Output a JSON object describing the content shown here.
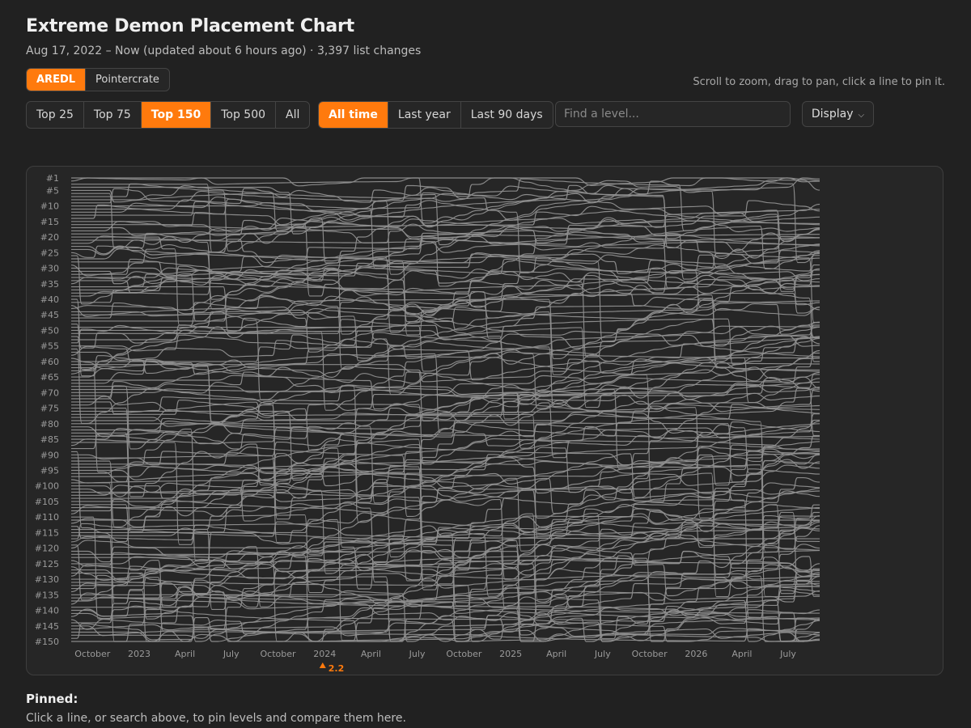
{
  "header": {
    "title": "Extreme Demon Placement Chart",
    "subtitle": "Aug 17, 2022 – Now (updated about 6 hours ago) · 3,397 list changes"
  },
  "source_tabs": [
    {
      "label": "AREDL",
      "active": true
    },
    {
      "label": "Pointercrate",
      "active": false
    }
  ],
  "hint": "Scroll to zoom, drag to pan, click a line to pin it.",
  "range_tabs": [
    {
      "label": "Top 25",
      "active": false
    },
    {
      "label": "Top 75",
      "active": false
    },
    {
      "label": "Top 150",
      "active": true
    },
    {
      "label": "Top 500",
      "active": false
    },
    {
      "label": "All",
      "active": false
    }
  ],
  "time_tabs": [
    {
      "label": "All time",
      "active": true
    },
    {
      "label": "Last year",
      "active": false
    },
    {
      "label": "Last 90 days",
      "active": false
    }
  ],
  "search": {
    "placeholder": "Find a level...",
    "value": ""
  },
  "display_menu": {
    "label": "Display"
  },
  "pinned": {
    "title": "Pinned:",
    "text": "Click a line, or search above, to pin levels and compare them here."
  },
  "colors": {
    "accent": "#ff7a0d",
    "line": "#8f8f8f",
    "background": "#212121",
    "panel": "#262626"
  },
  "chart_data": {
    "type": "line",
    "ylabels": [
      "#1",
      "#5",
      "#10",
      "#15",
      "#20",
      "#25",
      "#30",
      "#35",
      "#40",
      "#45",
      "#50",
      "#55",
      "#60",
      "#65",
      "#70",
      "#75",
      "#80",
      "#85",
      "#90",
      "#95",
      "#100",
      "#105",
      "#110",
      "#115",
      "#120",
      "#125",
      "#130",
      "#135",
      "#140",
      "#145",
      "#150"
    ],
    "ylabel_positions": [
      1,
      5,
      10,
      15,
      20,
      25,
      30,
      35,
      40,
      45,
      50,
      55,
      60,
      65,
      70,
      75,
      80,
      85,
      90,
      95,
      100,
      105,
      110,
      115,
      120,
      125,
      130,
      135,
      140,
      145,
      150
    ],
    "ylim": [
      1,
      150
    ],
    "xlim": [
      "2022-08-17",
      "2026-09-01"
    ],
    "xticks": [
      {
        "date": "2022-10-01",
        "label": "October"
      },
      {
        "date": "2023-01-01",
        "label": "2023"
      },
      {
        "date": "2023-04-01",
        "label": "April"
      },
      {
        "date": "2023-07-01",
        "label": "July"
      },
      {
        "date": "2023-10-01",
        "label": "October"
      },
      {
        "date": "2024-01-01",
        "label": "2024"
      },
      {
        "date": "2024-04-01",
        "label": "April"
      },
      {
        "date": "2024-07-01",
        "label": "July"
      },
      {
        "date": "2024-10-01",
        "label": "October"
      },
      {
        "date": "2025-01-01",
        "label": "2025"
      },
      {
        "date": "2025-04-01",
        "label": "April"
      },
      {
        "date": "2025-07-01",
        "label": "July"
      },
      {
        "date": "2025-10-01",
        "label": "October"
      },
      {
        "date": "2026-01-01",
        "label": "2026"
      },
      {
        "date": "2026-04-01",
        "label": "April"
      },
      {
        "date": "2026-07-01",
        "label": "July"
      }
    ],
    "markers": [
      {
        "date": "2023-12-28",
        "label": "2.2"
      }
    ],
    "series_count": 150,
    "grid": false
  }
}
